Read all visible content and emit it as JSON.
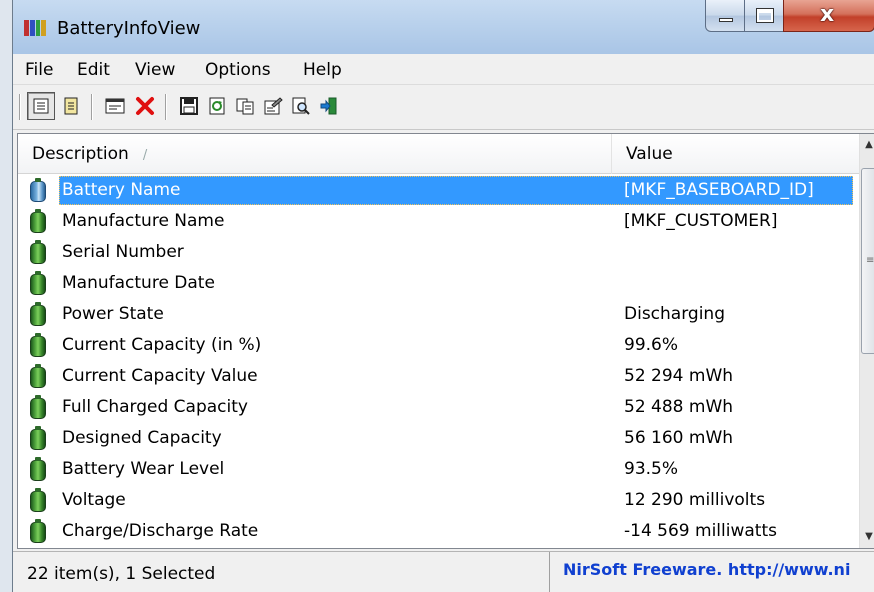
{
  "window": {
    "title": "BatteryInfoView",
    "controls": {
      "close_glyph": "x"
    }
  },
  "colors": {
    "title_gradient_top": "#c7dbf1",
    "selection": "#3399ff",
    "battery_green": "#4fa33c",
    "battery_selected_blue": "#76b0de",
    "link": "#1040d0",
    "delete_red": "#e01010"
  },
  "menu": {
    "items": [
      "File",
      "Edit",
      "View",
      "Options",
      "Help"
    ]
  },
  "toolbar": {
    "buttons": [
      {
        "icon": "battery-info-mode-icon",
        "pressed": true
      },
      {
        "icon": "battery-log-icon",
        "pressed": false
      },
      {
        "icon": "properties-window-icon",
        "pressed": false
      },
      {
        "icon": "delete-icon",
        "pressed": false
      },
      {
        "icon": "save-icon",
        "pressed": false
      },
      {
        "icon": "refresh-icon",
        "pressed": false
      },
      {
        "icon": "copy-icon",
        "pressed": false
      },
      {
        "icon": "properties-icon",
        "pressed": false
      },
      {
        "icon": "find-icon",
        "pressed": false
      },
      {
        "icon": "exit-icon",
        "pressed": false
      }
    ]
  },
  "list": {
    "columns": {
      "description": "Description",
      "value": "Value"
    },
    "sort_indicator": "/",
    "rows": [
      {
        "description": "Battery Name",
        "value": "[MKF_BASEBOARD_ID]",
        "selected": true
      },
      {
        "description": "Manufacture Name",
        "value": "[MKF_CUSTOMER]"
      },
      {
        "description": "Serial Number",
        "value": ""
      },
      {
        "description": "Manufacture Date",
        "value": ""
      },
      {
        "description": "Power State",
        "value": "Discharging"
      },
      {
        "description": "Current Capacity (in %)",
        "value": "99.6%"
      },
      {
        "description": "Current Capacity Value",
        "value": "52 294 mWh"
      },
      {
        "description": "Full Charged Capacity",
        "value": "52 488 mWh"
      },
      {
        "description": "Designed Capacity",
        "value": "56 160 mWh"
      },
      {
        "description": "Battery Wear Level",
        "value": "93.5%"
      },
      {
        "description": "Voltage",
        "value": "12 290 millivolts"
      },
      {
        "description": "Charge/Discharge Rate",
        "value": "-14 569 milliwatts"
      }
    ]
  },
  "status": {
    "count": "22 item(s), 1 Selected",
    "link": "NirSoft Freeware.  http://www.ni"
  }
}
